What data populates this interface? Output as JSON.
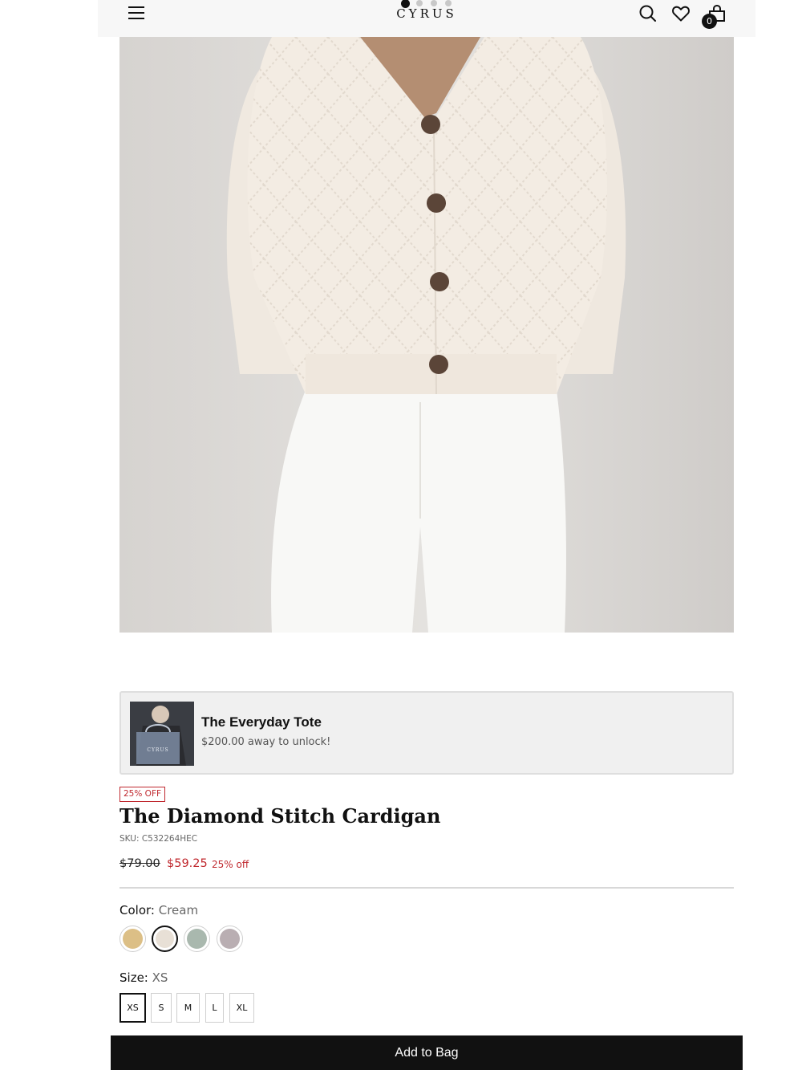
{
  "header": {
    "brand": "CYRUS",
    "cart_count": "0",
    "icons": [
      "menu-icon",
      "search-icon",
      "heart-icon",
      "shopping-bag-icon"
    ]
  },
  "gallery": {
    "slide_count": 4,
    "active_slide": 1
  },
  "promo": {
    "title": "The Everyday Tote",
    "subtitle": "$200.00 away to unlock!",
    "thumb_text": "CYRUS"
  },
  "product": {
    "badge": "25% OFF",
    "title": "The Diamond Stitch Cardigan",
    "sku": "SKU: C532264HEC",
    "price_original": "$79.00",
    "price_sale": "$59.25",
    "discount_label": "25% off"
  },
  "color": {
    "label": "Color:",
    "value": "Cream",
    "swatches": [
      {
        "color": "#dcbf86",
        "selected": false
      },
      {
        "color": "#e8e0d6",
        "selected": true
      },
      {
        "color": "#a9b8ae",
        "selected": false
      },
      {
        "color": "#b9aeb2",
        "selected": false
      }
    ]
  },
  "size": {
    "label": "Size:",
    "value": "XS",
    "options": [
      "XS",
      "S",
      "M",
      "L",
      "XL"
    ],
    "selected": "XS"
  },
  "cta": {
    "add_to_bag": "Add to Bag"
  },
  "colors": {
    "sale_red": "#c0282e",
    "header_bg": "#f7f7f7",
    "promo_bg": "#f0f0f0"
  }
}
